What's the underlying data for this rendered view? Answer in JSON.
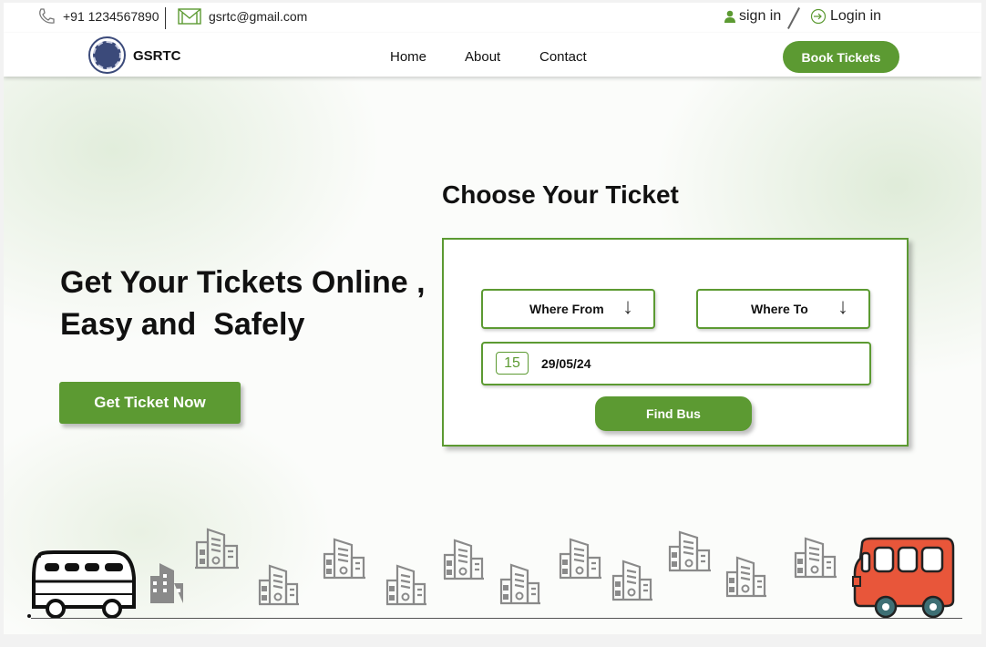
{
  "topbar": {
    "phone": "+91 1234567890",
    "email": "gsrtc@gmail.com",
    "sign_in": "sign in",
    "login": "Login in"
  },
  "nav": {
    "brand": "GSRTC",
    "links": [
      "Home",
      "About",
      "Contact"
    ],
    "book_label": "Book Tickets"
  },
  "hero": {
    "headline_line1": "Get Your Tickets Online ,",
    "headline_line2": "Easy and  Safely",
    "cta_label": "Get Ticket Now"
  },
  "booking": {
    "title": "Choose Your Ticket",
    "from_label": "Where From",
    "to_label": "Where To",
    "calendar_day": "15",
    "date_value": "29/05/24",
    "find_label": "Find Bus"
  },
  "colors": {
    "accent": "#5c9a32",
    "red_bus": "#e8563a",
    "building": "#8a8a8a"
  }
}
